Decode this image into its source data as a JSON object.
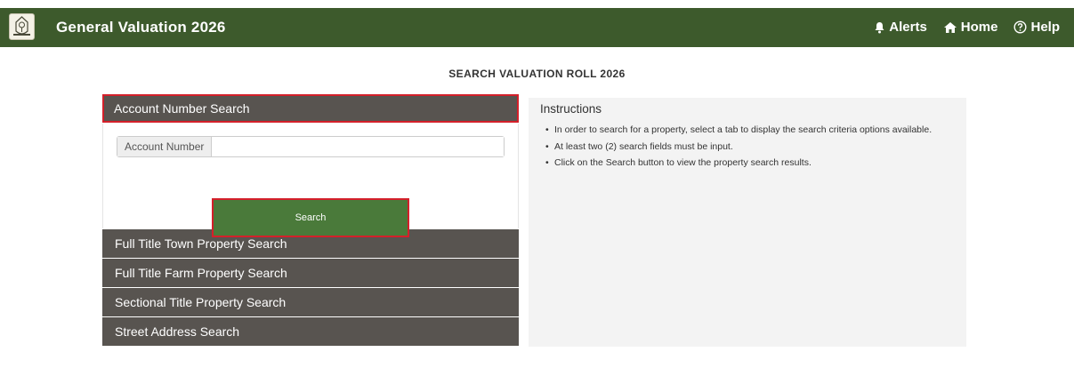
{
  "header": {
    "title": "General Valuation 2026",
    "logo": "municipal-crest-logo",
    "nav": [
      {
        "label": "Alerts",
        "icon": "bell-icon"
      },
      {
        "label": "Home",
        "icon": "home-icon"
      },
      {
        "label": "Help",
        "icon": "help-circle-icon"
      }
    ],
    "bar_color": "#3d5a2c"
  },
  "page_heading": "SEARCH VALUATION ROLL 2026",
  "accordion": {
    "active": {
      "label": "Account Number Search",
      "input_label": "Account Number",
      "input_value": "",
      "button_label": "Search"
    },
    "others": [
      "Full Title Town Property Search",
      "Full Title Farm Property Search",
      "Sectional Title Property Search",
      "Street Address Search"
    ]
  },
  "instructions": {
    "title": "Instructions",
    "items": [
      "In order to search for a property, select a tab to display the search criteria options available.",
      "At least two (2) search fields must be input.",
      "Click on the Search button to view the property search results."
    ]
  },
  "colors": {
    "accent_green": "#4a7a3a",
    "header_gray": "#585450",
    "highlight_red": "#d4202a"
  }
}
